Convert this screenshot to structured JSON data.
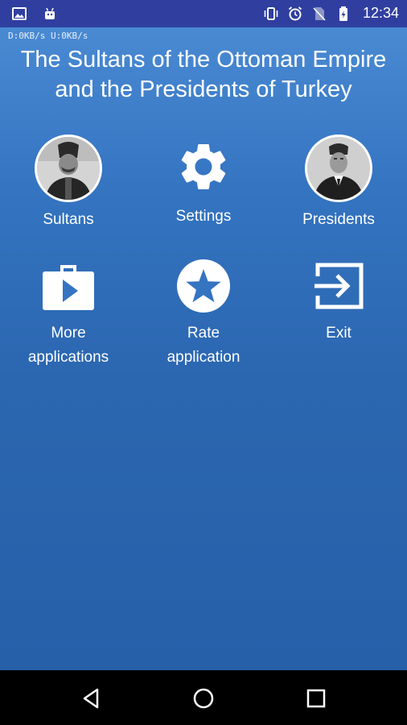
{
  "status_bar": {
    "time": "12:34",
    "left_icons": [
      "image-icon",
      "android-icon"
    ],
    "right_icons": [
      "vibrate-icon",
      "alarm-icon",
      "no-sim-icon",
      "battery-charging-icon"
    ]
  },
  "netspeed": "D:0KB/s  U:0KB/s",
  "title": {
    "line1": "The Sultans of the Ottoman Empire",
    "line2": "and the Presidents of Turkey"
  },
  "tiles": {
    "sultans": {
      "label": "Sultans",
      "icon": "sultan-portrait"
    },
    "settings": {
      "label": "Settings",
      "icon": "gear-icon"
    },
    "presidents": {
      "label": "Presidents",
      "icon": "president-portrait"
    },
    "more_apps": {
      "label_line1": "More",
      "label_line2": "applications",
      "icon": "play-store-bag-icon"
    },
    "rate_app": {
      "label_line1": "Rate",
      "label_line2": "application",
      "icon": "star-circle-icon"
    },
    "exit": {
      "label": "Exit",
      "icon": "exit-icon"
    }
  },
  "nav_bar": {
    "buttons": [
      "back",
      "home",
      "recents"
    ]
  },
  "colors": {
    "status_bar": "#303f9f",
    "gradient_top": "#4a8ad3",
    "gradient_bottom": "#2660a9",
    "nav_bar": "#000000"
  }
}
